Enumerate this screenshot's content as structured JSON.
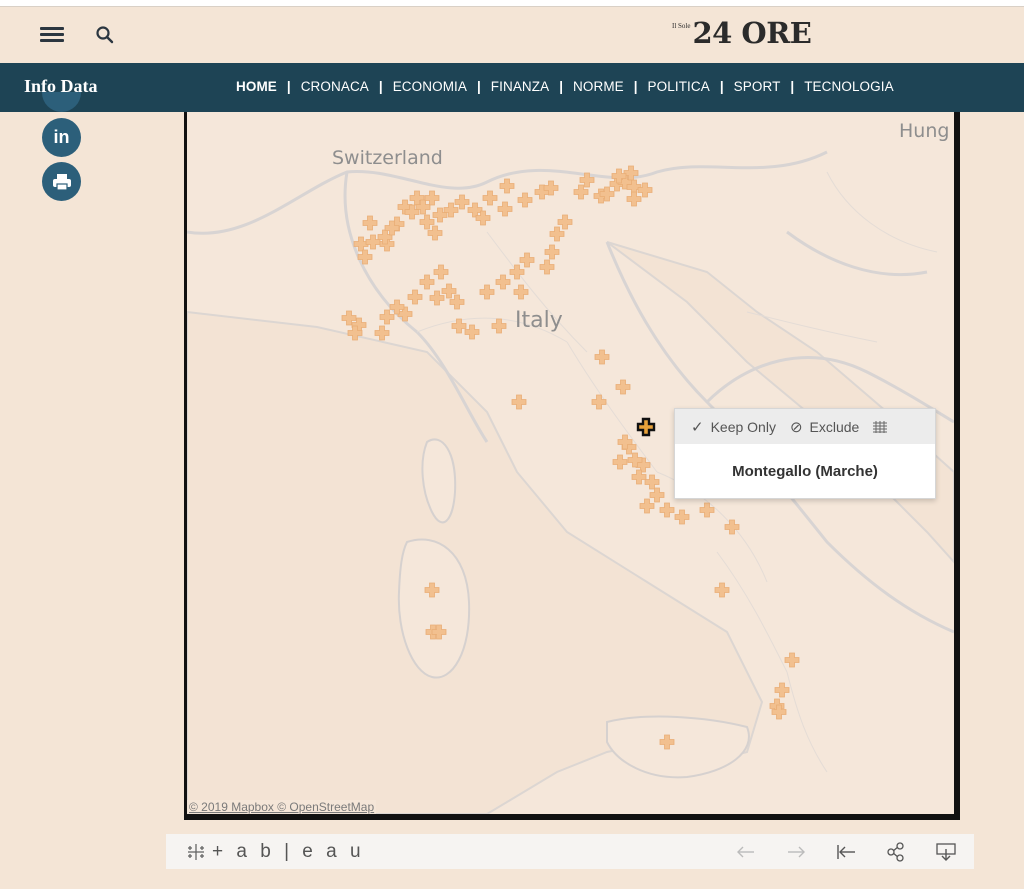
{
  "header": {
    "logo_small": "Il Sole",
    "logo_big": "24 ORE",
    "menu_icon": "menu-icon",
    "search_icon": "search-icon"
  },
  "nav": {
    "section_title": "Info Data",
    "items": [
      {
        "label": "HOME",
        "active": true
      },
      {
        "label": "CRONACA",
        "active": false
      },
      {
        "label": "ECONOMIA",
        "active": false
      },
      {
        "label": "FINANZA",
        "active": false
      },
      {
        "label": "NORME",
        "active": false
      },
      {
        "label": "POLITICA",
        "active": false
      },
      {
        "label": "SPORT",
        "active": false
      },
      {
        "label": "TECNOLOGIA",
        "active": false
      }
    ]
  },
  "social": {
    "linkedin_label": "in",
    "icons": [
      "linkedin-icon",
      "print-icon"
    ]
  },
  "map": {
    "labels": {
      "switzerland": "Switzerland",
      "italy": "Italy",
      "hungary": "Hung"
    },
    "attribution": "© 2019 Mapbox © OpenStreetMap",
    "marker_color": "#f2c08f",
    "selected_marker_color": "#e8a23a"
  },
  "tooltip": {
    "keep_only": "Keep Only",
    "exclude": "Exclude",
    "place": "Montegallo (Marche)"
  },
  "tableau": {
    "logo_text": "+ a b | e a u",
    "buttons": [
      "undo-icon",
      "redo-icon",
      "revert-icon",
      "share-icon",
      "download-icon"
    ]
  },
  "colors": {
    "page_bg": "#f4e5d6",
    "navbar_bg": "#1e4455",
    "social_bg": "#2c5f7a"
  }
}
